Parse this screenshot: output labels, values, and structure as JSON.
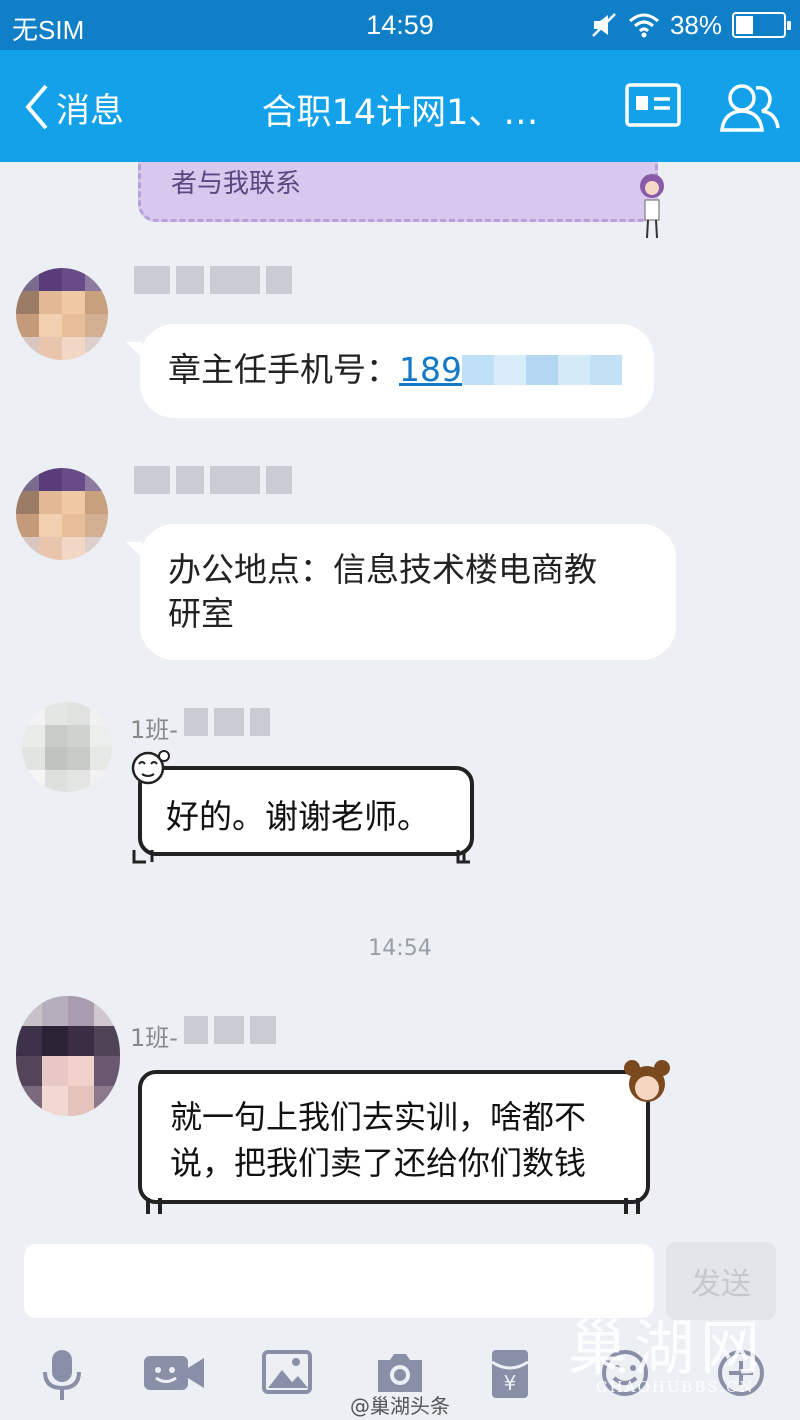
{
  "status_bar": {
    "carrier": "无SIM",
    "time": "14:59",
    "battery": "38%",
    "battery_level": 0.38
  },
  "nav": {
    "back_label": "消息",
    "title": "合职14计网1、…"
  },
  "messages": {
    "top_card_text": "者与我联系",
    "msg1_text": "章主任手机号：",
    "msg1_phone_visible": "189",
    "msg2_line1": "办公地点：信息技术楼电商教",
    "msg2_line2": "研室",
    "msg3_sender_prefix": "1班-",
    "msg3_text": "好的。谢谢老师。",
    "timestamp": "14:54",
    "msg4_sender_prefix": "1班-",
    "msg4_line1": "就一句上我们去实训，啥都不",
    "msg4_line2": "说，把我们卖了还给你们数钱"
  },
  "input": {
    "send_label": "发送",
    "placeholder": ""
  },
  "watermark": {
    "main": "巢湖网",
    "url": "CHAOHUBBS.CN",
    "handle": "@巢湖头条"
  }
}
